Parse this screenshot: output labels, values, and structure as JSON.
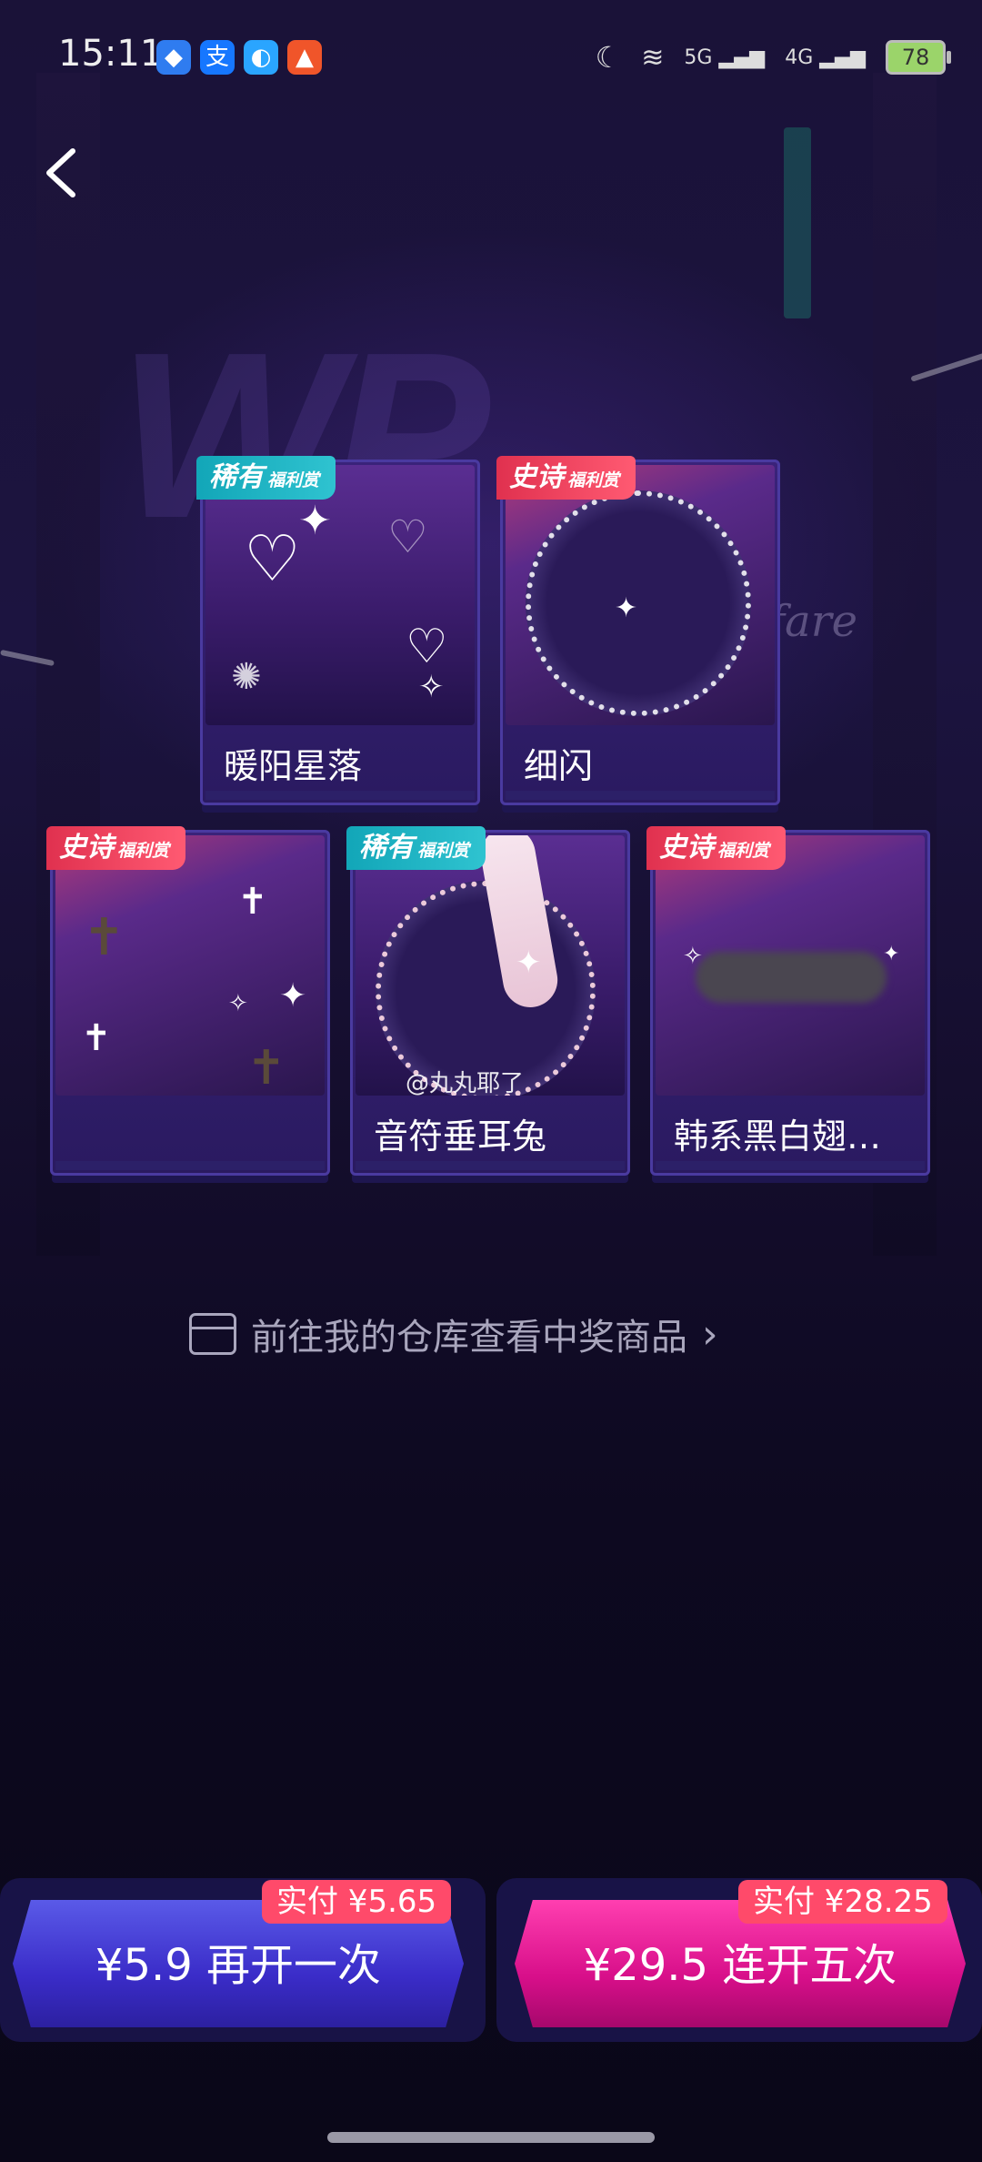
{
  "status_bar": {
    "time": "15:11",
    "network_1": "5G",
    "network_2": "4G",
    "battery": "78"
  },
  "background": {
    "decor_text": "lfare"
  },
  "prizes": [
    {
      "name": "暖阳星落",
      "tier": "稀有",
      "tier_sub": "福利赏"
    },
    {
      "name": "细闪",
      "tier": "史诗",
      "tier_sub": "福利赏"
    },
    {
      "name": "",
      "tier": "史诗",
      "tier_sub": "福利赏"
    },
    {
      "name": "音符垂耳兔",
      "tier": "稀有",
      "tier_sub": "福利赏"
    },
    {
      "name": "韩系黑白翅…",
      "tier": "史诗",
      "tier_sub": "福利赏"
    }
  ],
  "watermark": "@丸丸耶了",
  "warehouse_link": "前往我的仓库查看中奖商品",
  "actions": {
    "open_once": {
      "label": "¥5.9 再开一次",
      "pay": "实付 ¥5.65"
    },
    "open_five": {
      "label": "¥29.5 连开五次",
      "pay": "实付 ¥28.25"
    }
  },
  "colors": {
    "rare": "#1fb3c4",
    "epic": "#f03d5c",
    "blue_button": "#3a2cc8",
    "pink_button": "#d80f8a"
  }
}
